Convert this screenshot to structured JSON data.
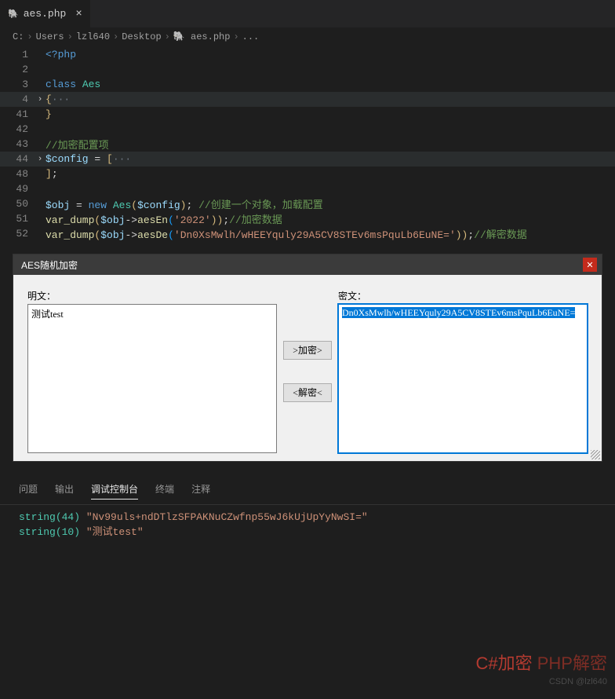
{
  "tab": {
    "name": "aes.php",
    "icon": "🐘"
  },
  "breadcrumb": [
    "C:",
    "Users",
    "lzl640",
    "Desktop",
    "🐘 aes.php",
    "..."
  ],
  "code": {
    "l1": {
      "n": "1",
      "php_open": "<?php"
    },
    "l2": {
      "n": "2"
    },
    "l3": {
      "n": "3",
      "kw_class": "class",
      "cls": "Aes"
    },
    "l4": {
      "n": "4",
      "br_open": "{",
      "fold": "···"
    },
    "l41": {
      "n": "41",
      "br_close": "}"
    },
    "l42": {
      "n": "42"
    },
    "l43": {
      "n": "43",
      "comment": "//加密配置项"
    },
    "l44": {
      "n": "44",
      "var": "$config",
      "eq": " = ",
      "br": "[",
      "fold": "···"
    },
    "l48": {
      "n": "48",
      "br2": "]",
      "semi": ";"
    },
    "l49": {
      "n": "49"
    },
    "l50": {
      "n": "50",
      "var": "$obj",
      "eq": " = ",
      "new": "new",
      "cls": "Aes",
      "p1": "(",
      "arg": "$config",
      "p2": ")",
      "semi": ";",
      "comment": " //创建一个对象，加载配置"
    },
    "l51": {
      "n": "51",
      "fn": "var_dump",
      "p1": "(",
      "var": "$obj",
      "arrow": "->",
      "method": "aesEn",
      "p2": "(",
      "str": "'2022'",
      "p3": "))",
      "semi": ";",
      "comment": "//加密数据"
    },
    "l52": {
      "n": "52",
      "fn": "var_dump",
      "p1": "(",
      "var": "$obj",
      "arrow": "->",
      "method": "aesDe",
      "p2": "(",
      "str": "'Dn0XsMwlh/wHEEYquly29A5CV8STEv6msPquLb6EuNE='",
      "p3": "))",
      "semi": ";",
      "comment": "//解密数据"
    }
  },
  "panel": {
    "title": "AES随机加密",
    "plain_label": "明文：",
    "plain_value": "测试test",
    "cipher_label": "密文：",
    "cipher_value": "Dn0XsMwlh/wHEEYquly29A5CV8STEv6msPquLb6EuNE=",
    "encrypt_btn": ">加密>",
    "decrypt_btn": "<解密<"
  },
  "terminal": {
    "tabs": {
      "problems": "问题",
      "output": "输出",
      "debug": "调试控制台",
      "term": "终端",
      "comments": "注释"
    },
    "line1": {
      "type": "string",
      "len": "(44)",
      "val": " \"Nv99uls+ndDTlzSFPAKNuCZwfnp55wJ6kUjUpYyNwSI=\""
    },
    "line2": {
      "type": "string",
      "len": "(10)",
      "val": " \"测试test\""
    }
  },
  "watermark": {
    "csharp": "C#加密 ",
    "php": "PHP解密",
    "credit": "CSDN @lzl640"
  }
}
